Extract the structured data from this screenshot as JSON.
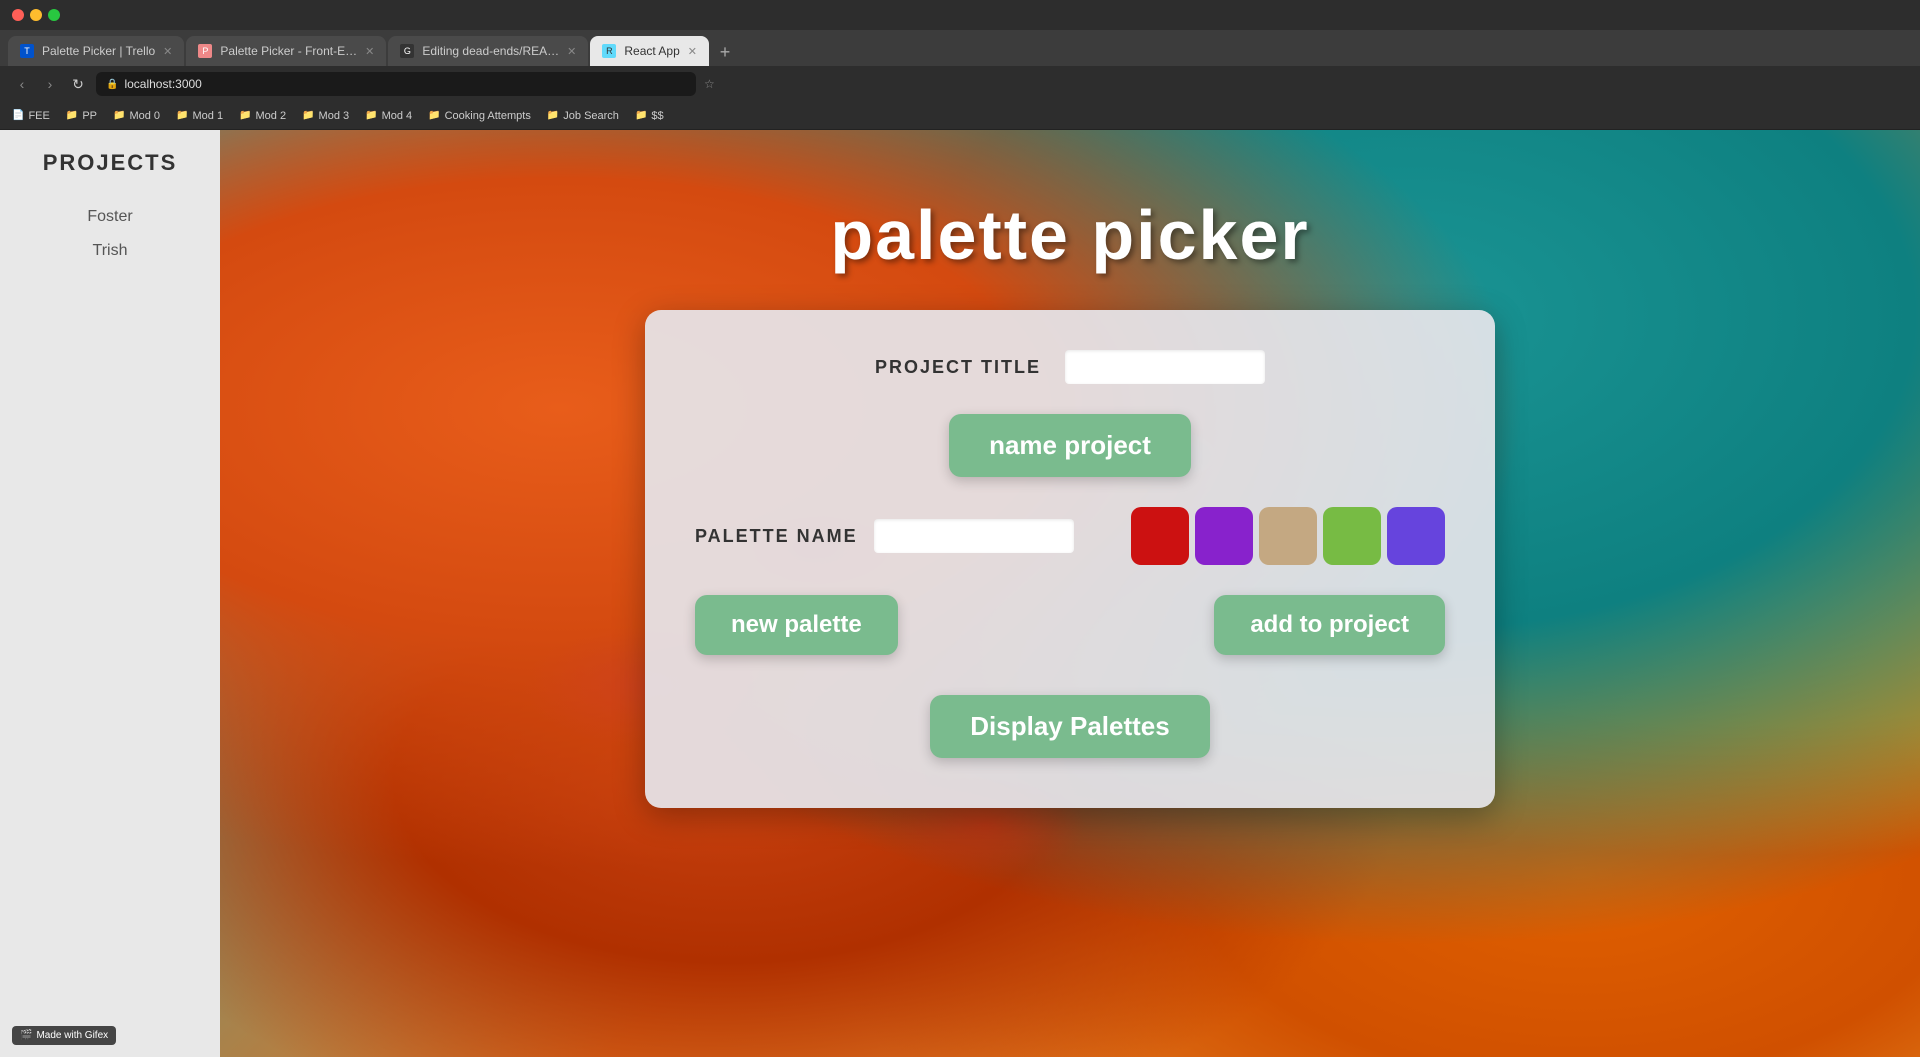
{
  "browser": {
    "tabs": [
      {
        "id": "tab1",
        "title": "Palette Picker | Trello",
        "favicon": "T",
        "active": false,
        "closeable": true
      },
      {
        "id": "tab2",
        "title": "Palette Picker - Front-End Eng...",
        "favicon": "P",
        "active": false,
        "closeable": true
      },
      {
        "id": "tab3",
        "title": "Editing dead-ends/README.m...",
        "favicon": "G",
        "active": false,
        "closeable": true
      },
      {
        "id": "tab4",
        "title": "React App",
        "favicon": "R",
        "active": true,
        "closeable": true
      }
    ],
    "url": "localhost:3000",
    "bookmarks": [
      {
        "label": "FEE",
        "icon": "📄"
      },
      {
        "label": "PP",
        "icon": "📁"
      },
      {
        "label": "Mod 0",
        "icon": "📁"
      },
      {
        "label": "Mod 1",
        "icon": "📁"
      },
      {
        "label": "Mod 2",
        "icon": "📁"
      },
      {
        "label": "Mod 3",
        "icon": "📁"
      },
      {
        "label": "Mod 4",
        "icon": "📁"
      },
      {
        "label": "Cooking Attempts",
        "icon": "📁"
      },
      {
        "label": "Job Search",
        "icon": "📁"
      },
      {
        "label": "$$",
        "icon": "📁"
      }
    ]
  },
  "sidebar": {
    "title": "PROJECTS",
    "projects": [
      {
        "id": "foster",
        "name": "Foster"
      },
      {
        "id": "trish",
        "name": "Trish"
      }
    ]
  },
  "app": {
    "title": "palette picker",
    "project_title_label": "PROJECT TITLE",
    "project_title_placeholder": "",
    "name_project_btn": "name project",
    "palette_name_label": "PALETTE NAME",
    "palette_name_placeholder": "",
    "colors": [
      {
        "id": "color1",
        "hex": "#cc1111"
      },
      {
        "id": "color2",
        "hex": "#8822cc"
      },
      {
        "id": "color3",
        "hex": "#c4a882"
      },
      {
        "id": "color4",
        "hex": "#77bb44"
      },
      {
        "id": "color5",
        "hex": "#6644dd"
      }
    ],
    "new_palette_btn": "new palette",
    "add_to_project_btn": "add to project",
    "display_palettes_btn": "Display Palettes"
  },
  "footer": {
    "made_with": "Made with Gifex"
  }
}
